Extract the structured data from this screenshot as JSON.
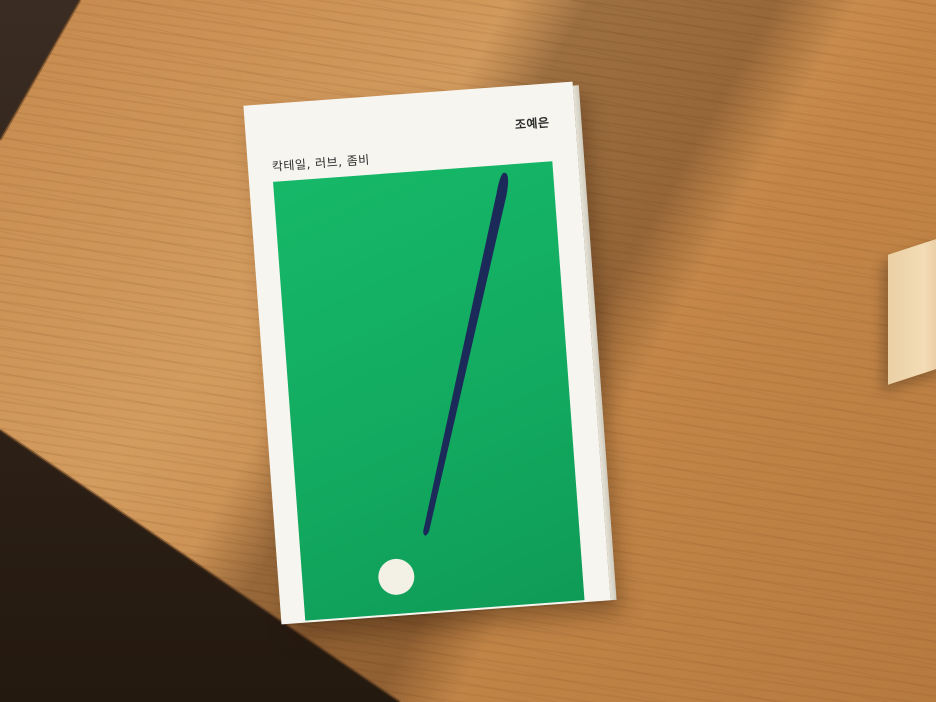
{
  "book": {
    "title": "칵테일, 러브, 좀비",
    "author": "조예은",
    "cover_green": "#12a95f",
    "stroke_color": "#1c2a5a",
    "dot_color": "#f3f0e6"
  },
  "scene": {
    "surface": "wooden-table",
    "icons": [
      "exclamation-mark-graphic"
    ]
  }
}
